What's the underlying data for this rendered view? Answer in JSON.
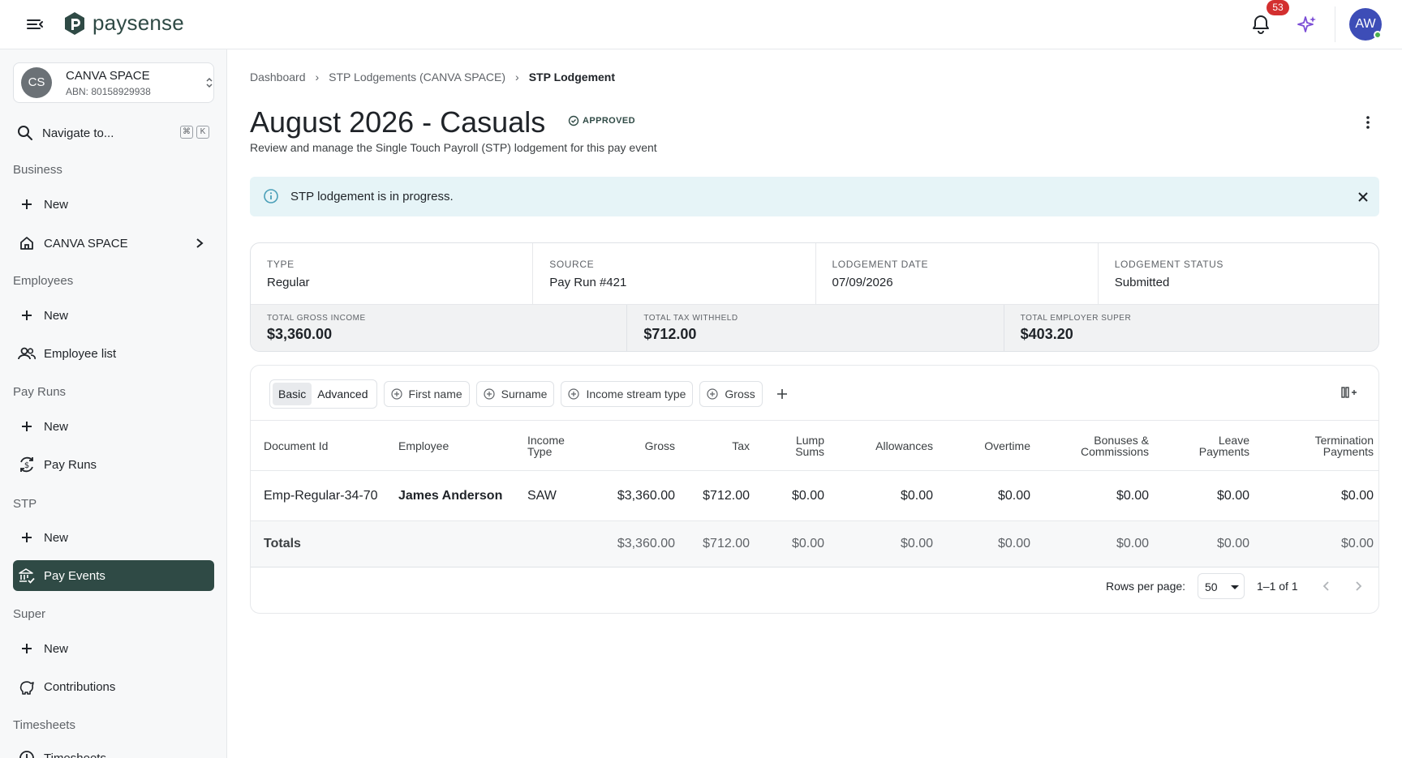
{
  "app": {
    "name": "paysense",
    "notification_count": "53",
    "user_initials": "AW",
    "accent_color": "#2f4a45",
    "badge_color": "#d32f2f",
    "avatar_color": "#3d4db7"
  },
  "org": {
    "initials": "CS",
    "name": "CANVA SPACE",
    "abn": "ABN: 80158929938"
  },
  "sidebar": {
    "search_label": "Navigate to...",
    "search_kbd": [
      "⌘",
      "K"
    ],
    "sections": {
      "business": "Business",
      "employees": "Employees",
      "pay_runs": "Pay Runs",
      "stp": "STP",
      "super": "Super",
      "timesheets": "Timesheets"
    },
    "items": {
      "business_new": "New",
      "business_org": "CANVA SPACE",
      "employees_new": "New",
      "employee_list": "Employee list",
      "pay_runs_new": "New",
      "pay_runs": "Pay Runs",
      "stp_new": "New",
      "pay_events": "Pay Events",
      "super_new": "New",
      "contributions": "Contributions",
      "timesheets": "Timesheets"
    }
  },
  "breadcrumb": [
    "Dashboard",
    "STP Lodgements (CANVA SPACE)",
    "STP Lodgement"
  ],
  "page": {
    "title": "August 2026 - Casuals",
    "status": "APPROVED",
    "subtitle": "Review and manage the Single Touch Payroll (STP) lodgement for this pay event"
  },
  "alert": {
    "text": "STP lodgement is in progress."
  },
  "summary": {
    "type_label": "TYPE",
    "type_value": "Regular",
    "source_label": "SOURCE",
    "source_value": "Pay Run #421",
    "date_label": "LODGEMENT DATE",
    "date_value": "07/09/2026",
    "status_label": "LODGEMENT STATUS",
    "status_value": "Submitted",
    "gross_label": "TOTAL GROSS INCOME",
    "gross_value": "$3,360.00",
    "tax_label": "TOTAL TAX WITHHELD",
    "tax_value": "$712.00",
    "super_label": "TOTAL EMPLOYER SUPER",
    "super_value": "$403.20"
  },
  "filters": {
    "basic": "Basic",
    "advanced": "Advanced",
    "chips": [
      "First name",
      "Surname",
      "Income stream type",
      "Gross"
    ]
  },
  "table": {
    "columns": [
      [
        "Document Id"
      ],
      [
        "Employee"
      ],
      [
        "Income",
        "Type"
      ],
      [
        "Gross"
      ],
      [
        "Tax"
      ],
      [
        "Lump",
        "Sums"
      ],
      [
        "Allowances"
      ],
      [
        "Overtime"
      ],
      [
        "Bonuses &",
        "Commissions"
      ],
      [
        "Leave",
        "Payments"
      ],
      [
        "Termination",
        "Payments"
      ]
    ],
    "rows": [
      {
        "document_id": "Emp-Regular-34-70",
        "employee": "James Anderson",
        "income_type": "SAW",
        "gross": "$3,360.00",
        "tax": "$712.00",
        "lump_sums": "$0.00",
        "allowances": "$0.00",
        "overtime": "$0.00",
        "bonuses": "$0.00",
        "leave": "$0.00",
        "termination": "$0.00"
      }
    ],
    "totals": {
      "label": "Totals",
      "gross": "$3,360.00",
      "tax": "$712.00",
      "lump_sums": "$0.00",
      "allowances": "$0.00",
      "overtime": "$0.00",
      "bonuses": "$0.00",
      "leave": "$0.00",
      "termination": "$0.00"
    }
  },
  "pagination": {
    "rows_per_page_label": "Rows per page:",
    "rows_per_page": "50",
    "range": "1–1 of 1"
  }
}
